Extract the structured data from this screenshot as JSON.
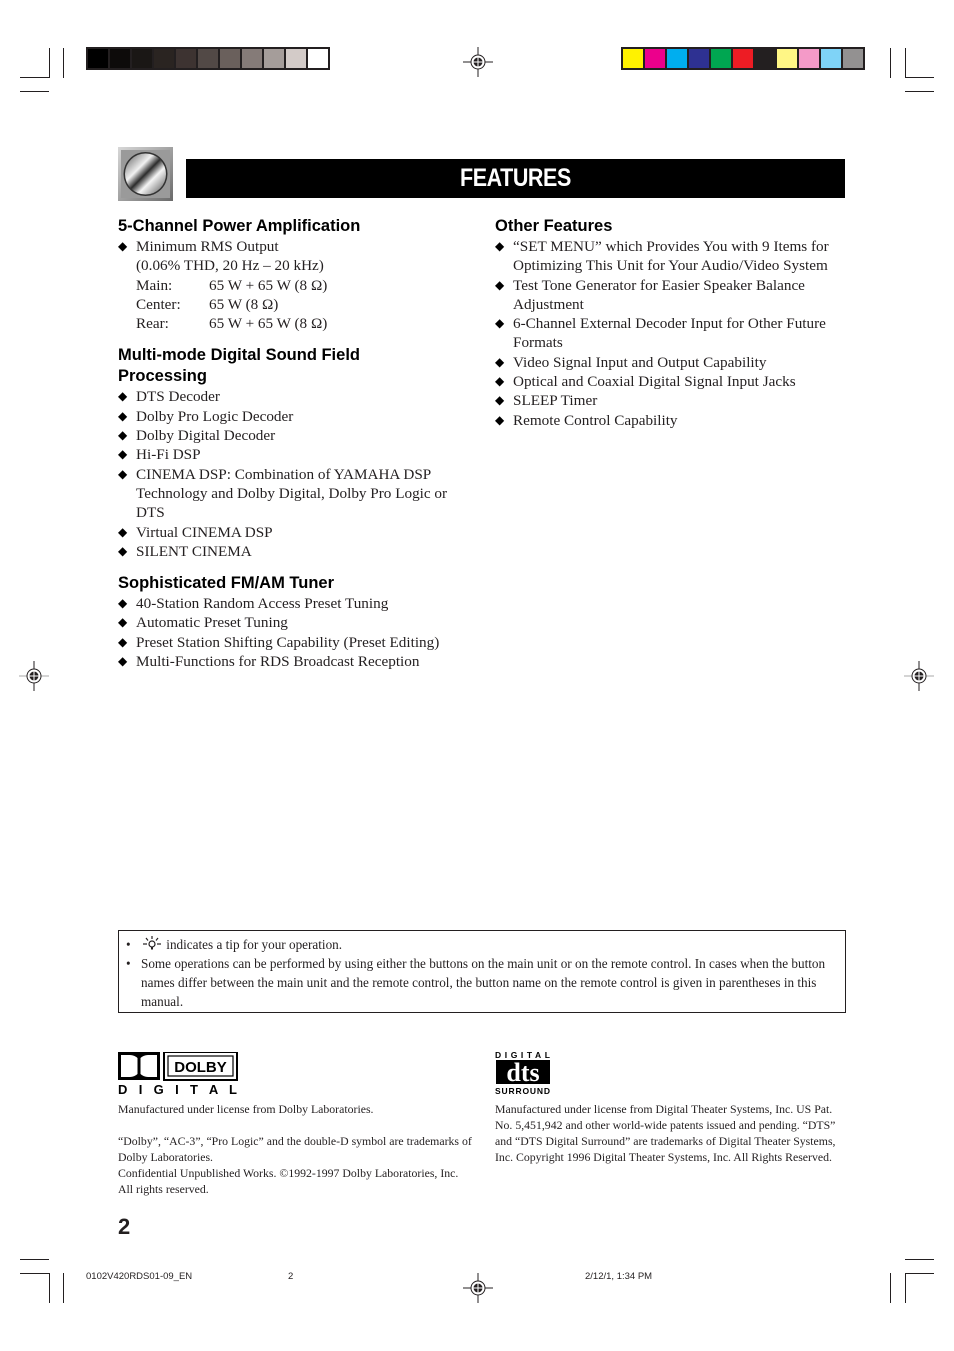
{
  "header": {
    "title": "FEATURES",
    "grayscale_bar": [
      "#000000",
      "#0d0b0a",
      "#1a1715",
      "#2a2421",
      "#3d3331",
      "#524946",
      "#6a605c",
      "#857b78",
      "#a59d9a",
      "#d3cbc8",
      "#ffffff"
    ],
    "color_bar": [
      "#fff200",
      "#ec008c",
      "#00aeef",
      "#2e3192",
      "#00a651",
      "#ed1c24",
      "#231f20",
      "#fff685",
      "#f49ac8",
      "#7fd3f7",
      "#939191"
    ]
  },
  "left_column": {
    "sections": [
      {
        "heading": "5-Channel Power Amplification",
        "item": "Minimum RMS Output",
        "spec_condition": "(0.06% THD, 20 Hz – 20 kHz)",
        "specs": [
          {
            "label": "Main:",
            "value": "65 W + 65 W (8 Ω)"
          },
          {
            "label": "Center:",
            "value": "65 W (8 Ω)"
          },
          {
            "label": "Rear:",
            "value": "65 W + 65 W (8 Ω)"
          }
        ]
      },
      {
        "heading": "Multi-mode Digital Sound Field Processing",
        "items": [
          "DTS Decoder",
          "Dolby Pro Logic Decoder",
          "Dolby Digital Decoder",
          "Hi-Fi DSP",
          "CINEMA DSP: Combination of YAMAHA DSP Technology and Dolby Digital, Dolby Pro Logic or DTS",
          "Virtual CINEMA DSP",
          "SILENT CINEMA"
        ]
      },
      {
        "heading": "Sophisticated FM/AM Tuner",
        "items": [
          "40-Station Random Access Preset Tuning",
          "Automatic Preset Tuning",
          "Preset Station Shifting Capability (Preset Editing)",
          "Multi-Functions for RDS Broadcast Reception"
        ]
      }
    ]
  },
  "right_column": {
    "heading": "Other Features",
    "items": [
      "“SET MENU” which Provides You with 9 Items for Optimizing This Unit for Your Audio/Video System",
      "Test Tone Generator for Easier Speaker Balance Adjustment",
      "6-Channel External Decoder Input for Other Future Formats",
      "Video Signal Input and Output Capability",
      "Optical and Coaxial Digital Signal Input Jacks",
      "SLEEP Timer",
      "Remote Control Capability"
    ]
  },
  "tip_box": {
    "bullet": "•",
    "tip_icon": "lightbulb-tip-icon",
    "line1": "indicates a tip for your operation.",
    "line2": "Some operations can be performed by using either the buttons on the main unit or on the remote control. In cases when the button names differ between the main unit and the remote control, the button name on the remote control is given in parentheses in this manual."
  },
  "dolby": {
    "logo_word": "DOLBY",
    "logo_sub": "D I G I T A L",
    "line1": "Manufactured under license from Dolby Laboratories.",
    "line2": "“Dolby”, “AC-3”, “Pro Logic” and the double-D symbol are trademarks of Dolby Laboratories.",
    "line3": "Confidential Unpublished Works. ©1992-1997 Dolby Laboratories, Inc. All rights reserved."
  },
  "dts": {
    "logo_top": "DIGITAL",
    "logo_mid": "dts",
    "logo_bottom": "SURROUND",
    "text": "Manufactured under license from Digital Theater Systems, Inc. US Pat. No. 5,451,942 and other world-wide patents issued and pending. “DTS” and “DTS Digital Surround” are trademarks of Digital Theater Systems, Inc. Copyright 1996 Digital Theater Systems, Inc. All Rights Reserved."
  },
  "footer": {
    "page_number": "2",
    "slug_file": "0102V420RDS01-09_EN",
    "slug_page": "2",
    "slug_date": "2/12/1, 1:34 PM"
  }
}
